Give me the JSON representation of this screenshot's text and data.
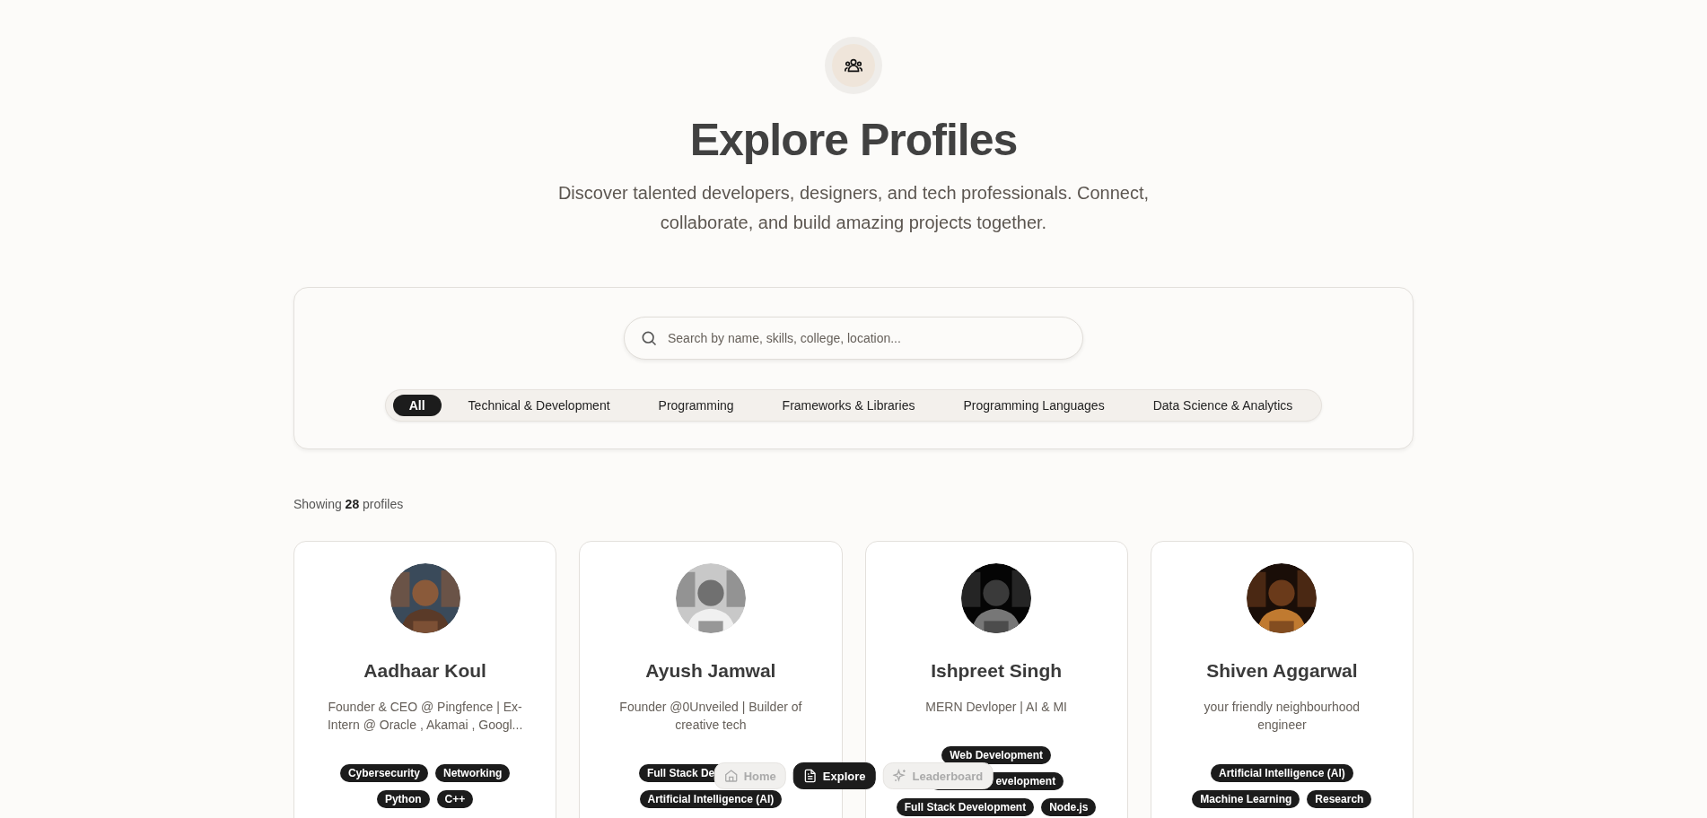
{
  "header": {
    "title": "Explore Profiles",
    "subtitle": "Discover talented developers, designers, and tech professionals. Connect, collaborate, and build amazing projects together."
  },
  "search": {
    "placeholder": "Search by name, skills, college, location..."
  },
  "filters": [
    {
      "label": "All",
      "selected": true
    },
    {
      "label": "Technical & Development",
      "selected": false
    },
    {
      "label": "Programming",
      "selected": false
    },
    {
      "label": "Frameworks & Libraries",
      "selected": false
    },
    {
      "label": "Programming Languages",
      "selected": false
    },
    {
      "label": "Data Science & Analytics",
      "selected": false
    }
  ],
  "results": "Showing **28** profiles",
  "profiles": [
    {
      "name": "Aadhaar Koul",
      "bio": "Founder & CEO @ Pingfence | Ex-Intern @ Oracle , Akamai , Googl...",
      "tags": [
        {
          "label": "Cybersecurity",
          "kind": "whole"
        },
        {
          "label": "Networking",
          "kind": "whole"
        },
        {
          "label": "Python",
          "kind": "whole"
        },
        {
          "label": "C++",
          "kind": "whole"
        }
      ]
    },
    {
      "name": "Ayush Jamwal",
      "bio": "Founder @0Unveiled | Builder of creative tech",
      "tags": [
        {
          "label": "Full Stack De",
          "kind": "covered-end"
        },
        {
          "label": "Artificial Intelligence (AI)",
          "kind": "whole"
        }
      ]
    },
    {
      "name": "Ishpreet Singh",
      "bio": "MERN Devloper | AI & MI",
      "tags": [
        {
          "label": "Web Development",
          "kind": "whole"
        },
        {
          "label": "evelopment",
          "kind": "covered-start"
        },
        {
          "label": "Full Stack Development",
          "kind": "whole"
        },
        {
          "label": "Node.js",
          "kind": "whole"
        }
      ]
    },
    {
      "name": "Shiven Aggarwal",
      "bio": "your friendly neighbourhood engineer",
      "tags": [
        {
          "label": "Artificial Intelligence (AI)",
          "kind": "whole"
        },
        {
          "label": "Machine Learning",
          "kind": "whole"
        },
        {
          "label": "Research",
          "kind": "whole"
        }
      ]
    }
  ],
  "nav": [
    {
      "label": "Home",
      "kind": "home",
      "selected": false
    },
    {
      "label": "Explore",
      "kind": "document",
      "selected": true
    },
    {
      "label": "Leaderboard",
      "kind": "sparkle",
      "selected": false
    }
  ]
}
